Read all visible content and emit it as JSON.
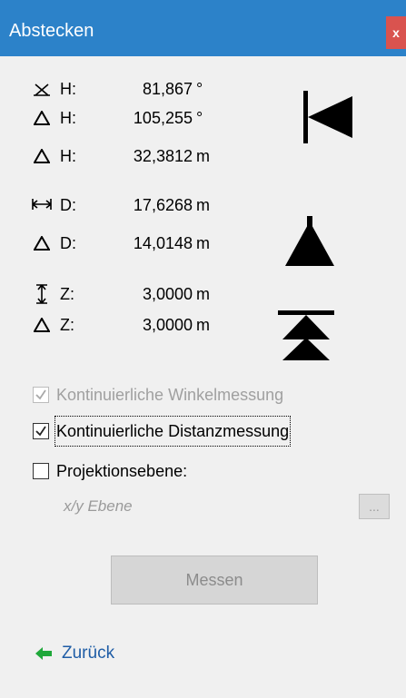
{
  "window": {
    "title": "Abstecken",
    "close_label": "x"
  },
  "measurements": [
    {
      "symbol_icon": "horizontal-angle-icon",
      "label": "H:",
      "value": "81,867",
      "unit": "°"
    },
    {
      "symbol_icon": "delta-icon",
      "label": "H:",
      "value": "105,255",
      "unit": "°"
    },
    {
      "symbol_icon": "delta-icon",
      "label": "H:",
      "value": "32,3812",
      "unit": "m"
    },
    {
      "symbol_icon": "horizontal-distance-icon",
      "label": "D:",
      "value": "17,6268",
      "unit": "m"
    },
    {
      "symbol_icon": "delta-icon",
      "label": "D:",
      "value": "14,0148",
      "unit": "m"
    },
    {
      "symbol_icon": "vertical-distance-icon",
      "label": "Z:",
      "value": "3,0000",
      "unit": "m"
    },
    {
      "symbol_icon": "delta-icon",
      "label": "Z:",
      "value": "3,0000",
      "unit": "m"
    }
  ],
  "direction_indicators": [
    "turn-left-indicator-icon",
    "move-forward-indicator-icon",
    "move-up-indicator-icon"
  ],
  "options": {
    "continuous_angle": {
      "label": "Kontinuierliche Winkelmessung",
      "checked": true,
      "enabled": false
    },
    "continuous_distance": {
      "label": "Kontinuierliche Distanzmessung",
      "checked": true,
      "enabled": true
    },
    "projection_plane": {
      "label": "Projektionsebene:",
      "checked": false,
      "enabled": true
    }
  },
  "projection": {
    "plane_value": "x/y Ebene",
    "browse_label": "..."
  },
  "actions": {
    "measure_label": "Messen",
    "back_label": "Zurück"
  },
  "colors": {
    "titlebar": "#2c82c9",
    "close": "#d9534f",
    "link": "#1f5da6",
    "back_arrow": "#1fa83a"
  }
}
